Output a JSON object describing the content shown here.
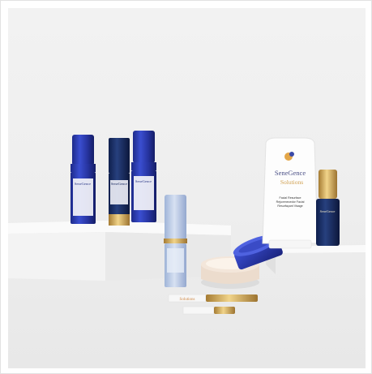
{
  "image": {
    "subject": "skincare-product-display",
    "brand_label_1": "SeneGence",
    "brand_label_2": "Solutions",
    "tube_text_line_1": "Facial Resurface",
    "tube_text_line_2": "Rejuvenecedor Facial",
    "tube_text_line_3": "Resurfaçant Visage"
  }
}
